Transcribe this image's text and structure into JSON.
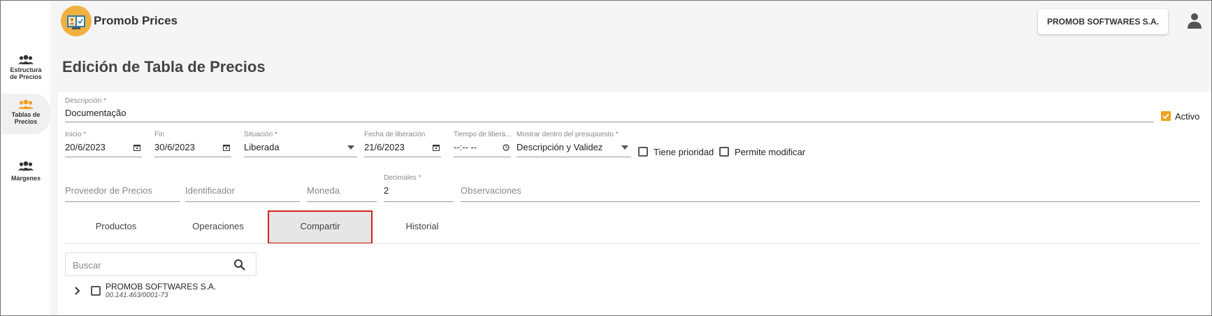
{
  "app": {
    "title": "Promob Prices"
  },
  "header": {
    "company": "PROMOB SOFTWARES S.A."
  },
  "sidebar": {
    "items": [
      {
        "label": "Estructura de Precios"
      },
      {
        "label": "Tablas de Precios"
      },
      {
        "label": "Márgenes"
      }
    ]
  },
  "page": {
    "title": "Edición de Tabla de Precios"
  },
  "form": {
    "descripcion": {
      "label": "Descripción *",
      "value": "Documentação"
    },
    "activo": {
      "label": "Activo",
      "checked": true
    },
    "inicio": {
      "label": "Inicio *",
      "value": "20/6/2023"
    },
    "fin": {
      "label": "Fin",
      "value": "30/6/2023"
    },
    "situacion": {
      "label": "Situación *",
      "value": "Liberada"
    },
    "fecha_liberacion": {
      "label": "Fecha de liberación",
      "value": "21/6/2023"
    },
    "tiempo_liberacion": {
      "label": "Tiempo de libera...",
      "value": "--:-- --"
    },
    "mostrar": {
      "label": "Mostrar dentro del presupuesto *",
      "value": "Descripción y Validez"
    },
    "tiene_prioridad": {
      "label": "Tiene prioridad",
      "checked": false
    },
    "permite_modificar": {
      "label": "Permite modificar",
      "checked": false
    },
    "proveedor": {
      "placeholder": "Proveedor de Precios"
    },
    "identificador": {
      "placeholder": "Identificador"
    },
    "moneda": {
      "placeholder": "Moneda"
    },
    "decimales": {
      "label": "Decimales *",
      "value": "2"
    },
    "observaciones": {
      "placeholder": "Observaciones"
    }
  },
  "tabs": [
    {
      "label": "Productos"
    },
    {
      "label": "Operaciones"
    },
    {
      "label": "Compartir",
      "active": true
    },
    {
      "label": "Historial"
    }
  ],
  "search": {
    "placeholder": "Buscar"
  },
  "tree": {
    "items": [
      {
        "name": "PROMOB SOFTWARES S.A.",
        "id": "00.141.463/0001-73"
      }
    ]
  },
  "colors": {
    "accent": "#f0a020",
    "highlight": "#d42020"
  }
}
